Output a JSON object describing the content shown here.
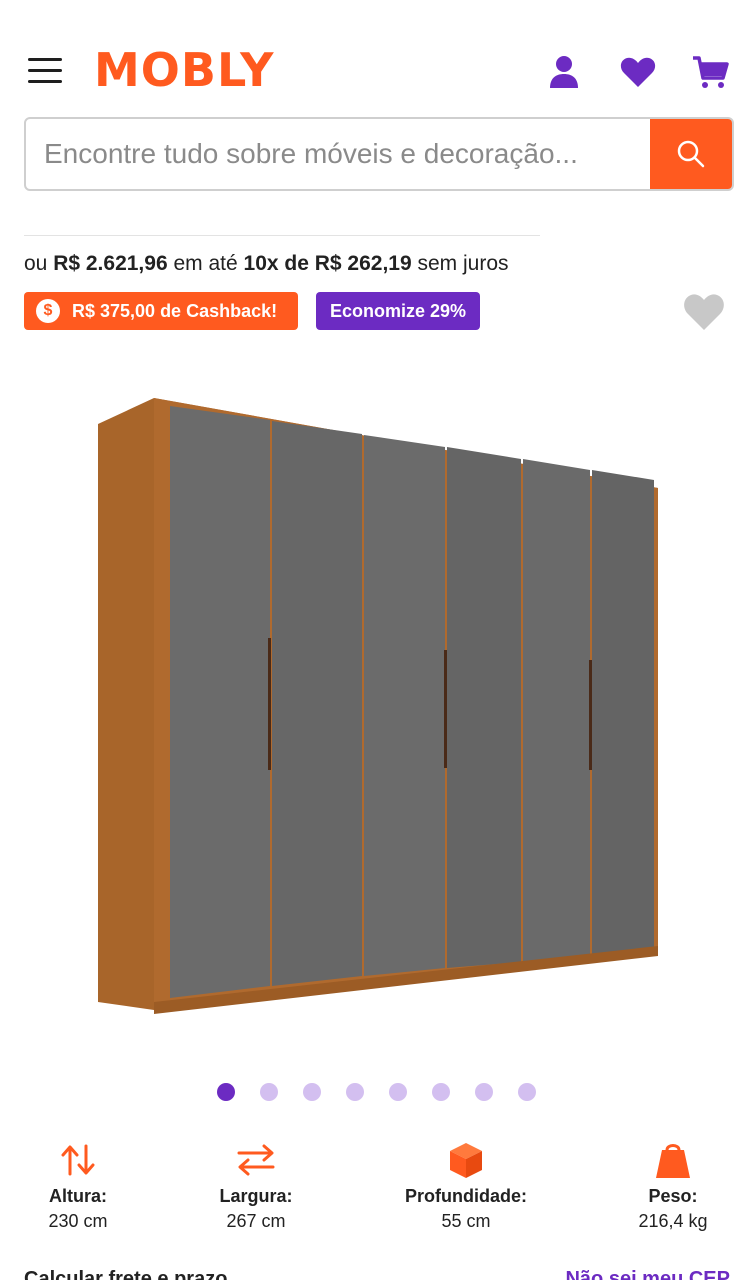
{
  "header": {
    "logo_text": "MOBLY",
    "icons": {
      "menu": "hamburger-menu-icon",
      "account": "user-icon",
      "wishlist": "heart-icon",
      "cart": "cart-icon"
    }
  },
  "search": {
    "placeholder": "Encontre tudo sobre móveis e decoração...",
    "value": ""
  },
  "pricing": {
    "prefix": "ou",
    "total": "R$ 2.621,96",
    "middle": "em até",
    "installments": "10x de R$ 262,19",
    "suffix": "sem juros"
  },
  "badges": {
    "cashback_icon": "$",
    "cashback": "R$ 375,00 de Cashback!",
    "savings": "Economize 29%"
  },
  "gallery": {
    "image_icon": "wardrobe-product-image",
    "total_slides": 8,
    "active_slide": 1
  },
  "dimensions": [
    {
      "label": "Altura:",
      "value": "230 cm",
      "icon": "height-arrows-icon"
    },
    {
      "label": "Largura:",
      "value": "267 cm",
      "icon": "width-arrows-icon"
    },
    {
      "label": "Profundidade:",
      "value": "55 cm",
      "icon": "depth-box-icon"
    },
    {
      "label": "Peso:",
      "value": "216,4 kg",
      "icon": "weight-icon"
    }
  ],
  "shipping": {
    "calculate_label": "Calcular frete e prazo",
    "unknown_cep_link": "Não sei meu CEP"
  },
  "colors": {
    "brand_orange": "#ff5a1f",
    "brand_purple": "#6c2bc2",
    "dot_inactive": "#d3bff0",
    "heart_gray": "#c8c8c8",
    "wood": "#a8652a",
    "door_gray": "#6b6b6b"
  }
}
